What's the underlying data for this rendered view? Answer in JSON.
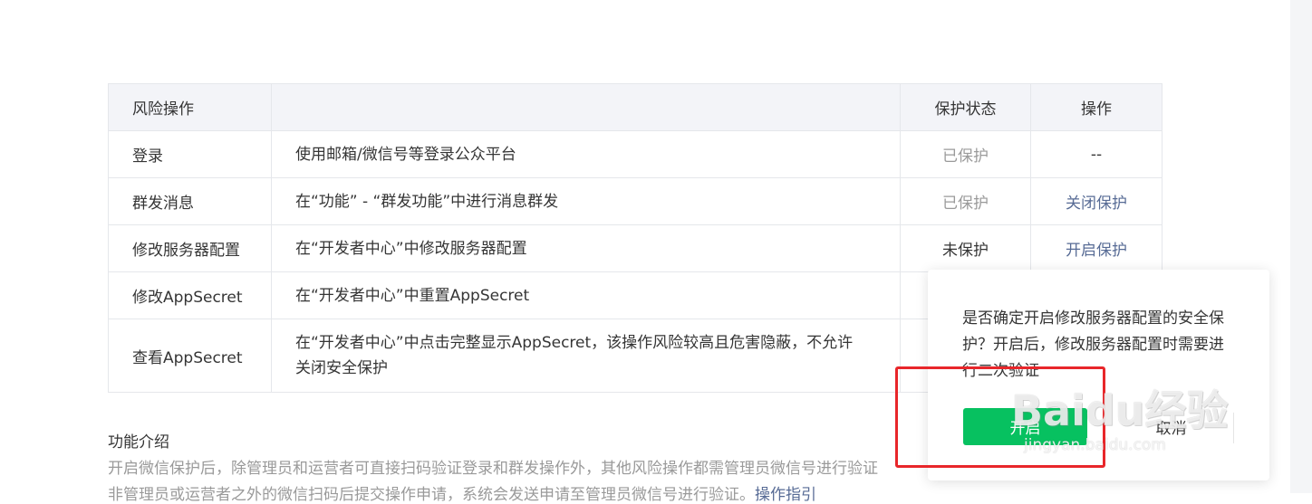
{
  "table": {
    "headers": [
      "风险操作",
      "",
      "保护状态",
      "操作"
    ],
    "rows": [
      {
        "name": "登录",
        "desc": "使用邮箱/微信号等登录公众平台",
        "status": "已保护",
        "action": "--"
      },
      {
        "name": "群发消息",
        "desc": "在“功能” - “群发功能”中进行消息群发",
        "status": "已保护",
        "action": "关闭保护"
      },
      {
        "name": "修改服务器配置",
        "desc": "在“开发者中心”中修改服务器配置",
        "status": "未保护",
        "action": "开启保护"
      },
      {
        "name": "修改AppSecret",
        "desc": "在“开发者中心”中重置AppSecret",
        "status": "",
        "action": ""
      },
      {
        "name": "查看AppSecret",
        "desc": "在“开发者中心”中点击完整显示AppSecret，该操作风险较高且危害隐蔽，不允许关闭安全保护",
        "status": "",
        "action": ""
      }
    ]
  },
  "intro": {
    "title": "功能介绍",
    "line1": "开启微信保护后，除管理员和运营者可直接扫码验证登录和群发操作外，其他风险操作都需管理员微信号进行验证",
    "line2": "非管理员或运营者之外的微信扫码后提交操作申请，系统会发送申请至管理员微信号进行验证。",
    "link": "操作指引"
  },
  "popover": {
    "message": "是否确定开启修改服务器配置的安全保护？开启后，修改服务器配置时需要进行二次验证",
    "confirm": "开启",
    "cancel": "取消"
  },
  "watermark": {
    "brand": "Baidu经验",
    "url": "jingyan.baidu.com"
  },
  "colors": {
    "link": "#576b95",
    "primary": "#07c160",
    "header_bg": "#f3f4f8",
    "highlight": "#e8262a"
  }
}
